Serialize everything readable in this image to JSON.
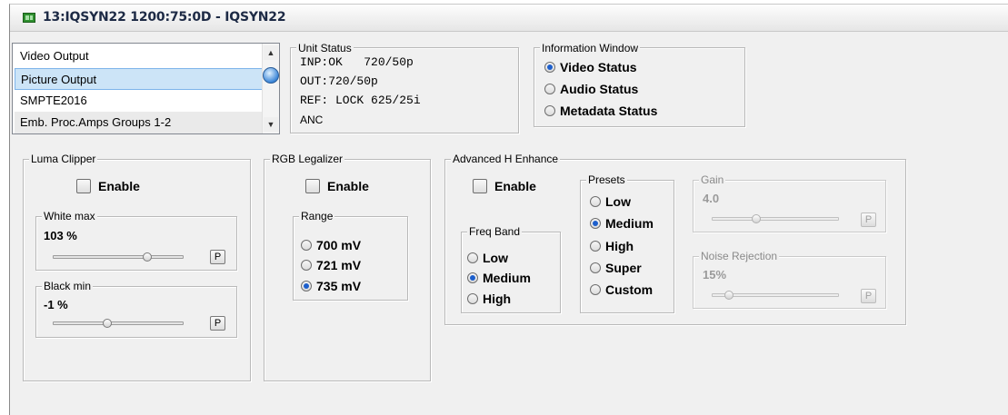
{
  "window": {
    "title": "13:IQSYN22  1200:75:0D  - IQSYN22"
  },
  "list": {
    "items": [
      "Video Output",
      "Picture Output",
      "SMPTE2016",
      "Emb. Proc.Amps Groups 1-2"
    ],
    "selected": "Picture Output"
  },
  "unit_status": {
    "title": "Unit Status",
    "lines": [
      "INP:OK   720/50p",
      "OUT:720/50p",
      "REF: LOCK 625/25i",
      "ANC"
    ]
  },
  "info_window": {
    "title": "Information Window",
    "options": [
      "Video Status",
      "Audio Status",
      "Metadata Status"
    ],
    "selected": "Video Status"
  },
  "luma_clipper": {
    "title": "Luma Clipper",
    "enable_label": "Enable",
    "enabled": false,
    "white_max": {
      "title": "White max",
      "value": "103 %",
      "slider_fraction": 0.73,
      "preset_label": "P"
    },
    "black_min": {
      "title": "Black min",
      "value": "-1 %",
      "slider_fraction": 0.4,
      "preset_label": "P"
    }
  },
  "rgb_legalizer": {
    "title": "RGB Legalizer",
    "enable_label": "Enable",
    "enabled": false,
    "range": {
      "title": "Range",
      "options": [
        "700 mV",
        "721 mV",
        "735 mV"
      ],
      "selected": "735 mV"
    }
  },
  "advanced_h_enhance": {
    "title": "Advanced H Enhance",
    "enable_label": "Enable",
    "enabled": false,
    "freq_band": {
      "title": "Freq Band",
      "options": [
        "Low",
        "Medium",
        "High"
      ],
      "selected": "Medium"
    },
    "presets": {
      "title": "Presets",
      "options": [
        "Low",
        "Medium",
        "High",
        "Super",
        "Custom"
      ],
      "selected": "Medium"
    },
    "gain": {
      "title": "Gain",
      "value": "4.0",
      "slider_fraction": 0.33,
      "preset_label": "P"
    },
    "noise_rejection": {
      "title": "Noise Rejection",
      "value": "15%",
      "slider_fraction": 0.1,
      "preset_label": "P"
    }
  },
  "colors": {
    "window_bg": "#f0f0f0",
    "selection": "#cce4f7",
    "radio_dot": "#1d5fcc",
    "title_text": "#1d2a45"
  }
}
